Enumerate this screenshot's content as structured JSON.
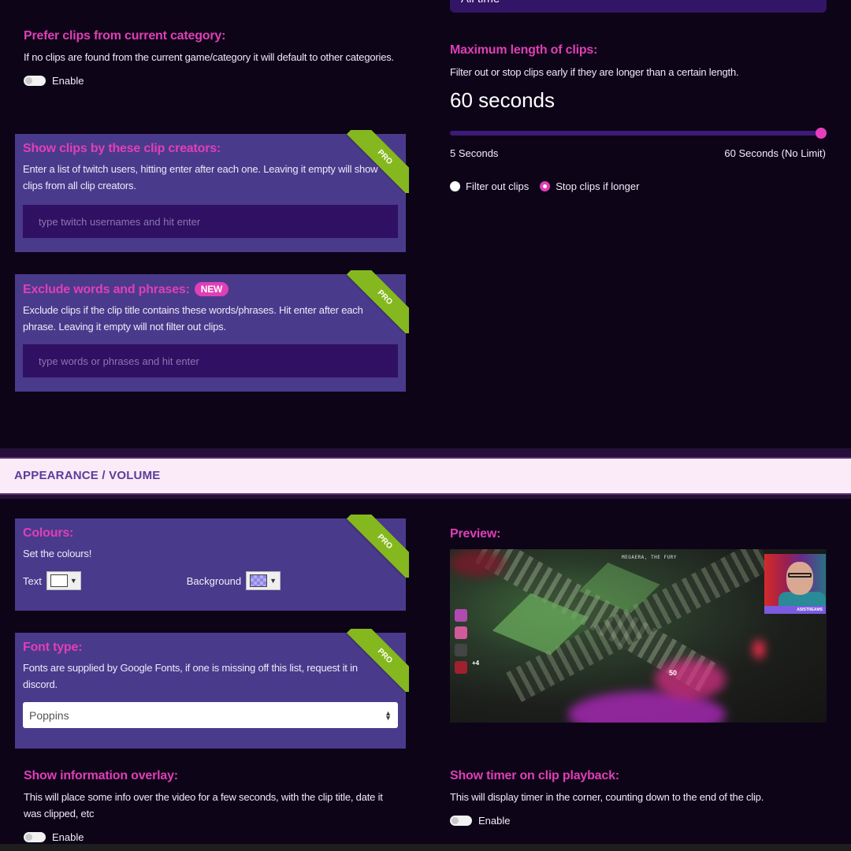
{
  "top_select": {
    "value": "All time"
  },
  "prefer_category": {
    "title": "Prefer clips from current category:",
    "description": "If no clips are found from the current game/category it will default to other categories.",
    "toggle_label": "Enable",
    "enabled": false
  },
  "clip_creators": {
    "title": "Show clips by these clip creators:",
    "description": "Enter a list of twitch users, hitting enter after each one. Leaving it empty will show clips from all clip creators.",
    "placeholder": "type twitch usernames and hit enter",
    "value": "",
    "ribbon": "PRO"
  },
  "exclude_words": {
    "title": "Exclude words and phrases:",
    "badge": "NEW",
    "description": "Exclude clips if the clip title contains these words/phrases. Hit enter after each phrase. Leaving it empty will not filter out clips.",
    "placeholder": "type words or phrases and hit enter",
    "value": "",
    "ribbon": "PRO"
  },
  "max_length": {
    "title": "Maximum length of clips:",
    "description": "Filter out or stop clips early if they are longer than a certain length.",
    "value_display": "60 seconds",
    "slider_min": 5,
    "slider_max": 60,
    "slider_value": 60,
    "min_label": "5 Seconds",
    "max_label": "60 Seconds (No Limit)",
    "options": [
      {
        "label": "Filter out clips",
        "selected": false
      },
      {
        "label": "Stop clips if longer",
        "selected": true
      }
    ]
  },
  "section": {
    "title": "APPEARANCE / VOLUME"
  },
  "colours": {
    "title": "Colours:",
    "description": "Set the colours!",
    "text_label": "Text",
    "text_color": "#ffffff",
    "background_label": "Background",
    "background_color": "transparent",
    "ribbon": "PRO"
  },
  "font_type": {
    "title": "Font type:",
    "description": "Fonts are supplied by Google Fonts, if one is missing off this list, request it in discord.",
    "selected": "Poppins",
    "ribbon": "PRO"
  },
  "preview": {
    "title": "Preview:",
    "boss_name": "MEGAERA, THE FURY",
    "streamer_tag": "ASISTREAMS",
    "damage_number": "50",
    "hud_value": "+4"
  },
  "info_overlay": {
    "title": "Show information overlay:",
    "description": "This will place some info over the video for a few seconds, with the clip title, date it was clipped, etc",
    "toggle_label": "Enable",
    "enabled": false
  },
  "timer": {
    "title": "Show timer on clip playback:",
    "description": "This will display timer in the corner, counting down to the end of the clip.",
    "toggle_label": "Enable",
    "enabled": false
  },
  "colors": {
    "accent_pink": "#e03fb6",
    "card_purple": "#4a3a8c",
    "input_purple": "#2f1063",
    "pro_green": "#85b81e",
    "page_bg": "#0d0418"
  }
}
